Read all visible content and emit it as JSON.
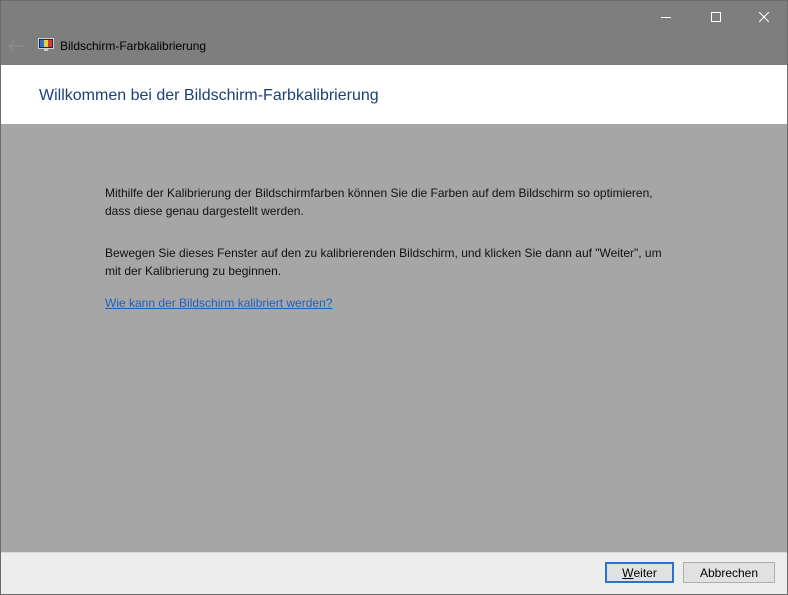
{
  "window": {
    "title": "Bildschirm-Farbkalibrierung",
    "icon": "monitor-color-icon"
  },
  "caption_buttons": {
    "minimize_icon": "minimize-icon",
    "maximize_icon": "maximize-icon",
    "close_icon": "close-icon"
  },
  "header": {
    "title": "Willkommen bei der Bildschirm-Farbkalibrierung"
  },
  "content": {
    "paragraph1": "Mithilfe der Kalibrierung der Bildschirmfarben können Sie die Farben auf dem Bildschirm so optimieren, dass diese genau dargestellt werden.",
    "paragraph2": "Bewegen Sie dieses Fenster auf den zu kalibrierenden Bildschirm, und klicken Sie dann auf \"Weiter\", um mit der Kalibrierung zu beginnen.",
    "help_link": "Wie kann der Bildschirm kalibriert werden?"
  },
  "footer": {
    "next_label_mnemonic": "W",
    "next_label_rest": "eiter",
    "cancel_label": "Abbrechen"
  },
  "colors": {
    "header_title": "#1a3f7a",
    "link": "#1f5fbf",
    "default_button_border": "#2b73c8"
  }
}
